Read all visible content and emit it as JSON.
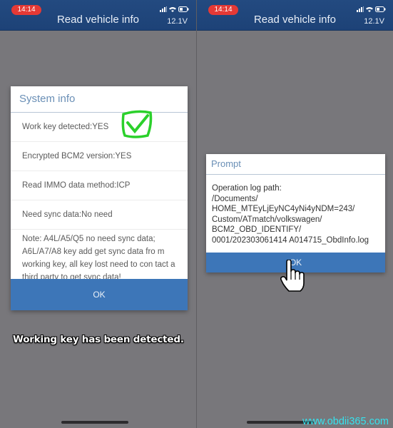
{
  "left_screen": {
    "status_bar": {
      "time": "14:14",
      "voltage": "12.1V",
      "icons": [
        "signal-icon",
        "wifi-icon",
        "battery-icon"
      ]
    },
    "header": {
      "title": "Read vehicle info"
    },
    "dialog": {
      "title": "System info",
      "rows": [
        "Work key detected:YES",
        "Encrypted BCM2 version:YES",
        "Read IMMO data method:ICP",
        "Need sync data:No need"
      ],
      "note": "Note: A4L/A5/Q5 no need sync data; A6L/A7/A8 key add get sync data fro m working key, all key lost need to con tact a third party to get sync data!",
      "ok_label": "OK"
    },
    "caption": "Working key has been detected.",
    "annotation": {
      "type": "green-checkmark",
      "color": "#2bd02b"
    }
  },
  "right_screen": {
    "status_bar": {
      "time": "14:14",
      "voltage": "12.1V",
      "icons": [
        "signal-icon",
        "wifi-icon",
        "battery-icon"
      ]
    },
    "header": {
      "title": "Read vehicle info"
    },
    "prompt": {
      "title": "Prompt",
      "body": "Operation log path:\n/Documents/\nHOME_MTEyLjEyNC4yNi4yNDM=243/\nCustom/ATmatch/volkswagen/\nBCM2_OBD_IDENTIFY/\n0001/202303061414 A014715_ObdInfo.log",
      "ok_label": "OK"
    }
  },
  "watermark": "www.obdii365.com",
  "colors": {
    "header_bg": "#1f4479",
    "accent_button": "#3d76b8",
    "time_badge": "#e53935",
    "watermark": "#35e3ee"
  }
}
